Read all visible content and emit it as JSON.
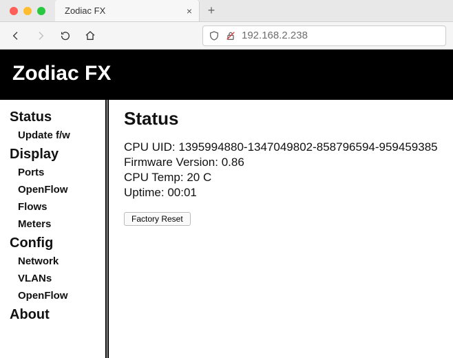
{
  "browser": {
    "tab_title": "Zodiac FX",
    "url": "192.168.2.238"
  },
  "app": {
    "title": "Zodiac FX"
  },
  "sidebar": {
    "sections": [
      {
        "heading": "Status",
        "items": [
          "Update f/w"
        ]
      },
      {
        "heading": "Display",
        "items": [
          "Ports",
          "OpenFlow",
          "Flows",
          "Meters"
        ]
      },
      {
        "heading": "Config",
        "items": [
          "Network",
          "VLANs",
          "OpenFlow"
        ]
      },
      {
        "heading": "About",
        "items": []
      }
    ]
  },
  "status": {
    "heading": "Status",
    "fields": {
      "cpu_uid_label": "CPU UID:",
      "cpu_uid_value": "1395994880-1347049802-858796594-959459385",
      "fw_label": "Firmware Version:",
      "fw_value": "0.86",
      "temp_label": "CPU Temp:",
      "temp_value": "20 C",
      "uptime_label": "Uptime:",
      "uptime_value": "00:01"
    },
    "factory_reset_label": "Factory Reset"
  }
}
